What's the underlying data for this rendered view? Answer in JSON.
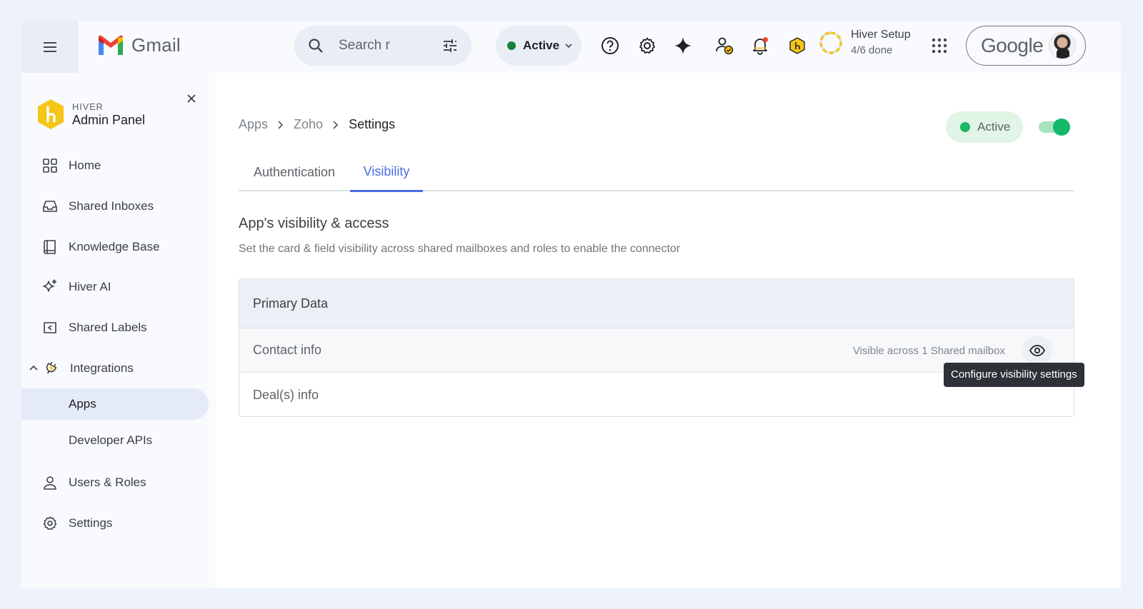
{
  "topbar": {
    "app_name": "Gmail",
    "search_placeholder": "Search r",
    "status_label": "Active",
    "setup_title": "Hiver Setup",
    "setup_progress": "4/6 done",
    "account_brand": "Google",
    "icons": [
      "menu-icon",
      "search-icon",
      "tune-icon",
      "help-icon",
      "gear-icon",
      "sparkle-icon",
      "user-check-icon",
      "bell-icon",
      "hiver-icon",
      "apps-grid-icon"
    ],
    "notification_dot_color": "#ea4335"
  },
  "sidebar": {
    "brand_small": "HIVER",
    "brand_title": "Admin Panel",
    "items": [
      {
        "label": "Home",
        "icon": "grid-icon"
      },
      {
        "label": "Shared Inboxes",
        "icon": "inbox-icon"
      },
      {
        "label": "Knowledge Base",
        "icon": "book-icon"
      },
      {
        "label": "Hiver AI",
        "icon": "sparkle-icon"
      },
      {
        "label": "Shared Labels",
        "icon": "label-icon"
      },
      {
        "label": "Integrations",
        "icon": "plug-icon"
      },
      {
        "label": "Apps",
        "icon": ""
      },
      {
        "label": "Developer APIs",
        "icon": ""
      },
      {
        "label": "Users & Roles",
        "icon": "user-icon"
      },
      {
        "label": "Settings",
        "icon": "gear-icon"
      }
    ]
  },
  "main": {
    "breadcrumb": [
      "Apps",
      "Zoho",
      "Settings"
    ],
    "status_badge": "Active",
    "toggle_on": true,
    "tabs": [
      {
        "label": "Authentication",
        "selected": false
      },
      {
        "label": "Visibility",
        "selected": true
      }
    ],
    "section_title": "App's visibility & access",
    "section_desc": "Set the card & field visibility across shared mailboxes and roles to enable the connector",
    "card": {
      "header": "Primary Data",
      "rows": [
        {
          "label": "Contact info",
          "visibility": "Visible across 1 Shared mailbox"
        },
        {
          "label": "Deal(s) info",
          "visibility": ""
        }
      ]
    },
    "tooltip": "Configure visibility settings"
  },
  "colors": {
    "accent": "#4a6ee0",
    "active_green": "#1fb866",
    "status_green": "#188038",
    "hiver_yellow": "#f5c518"
  }
}
